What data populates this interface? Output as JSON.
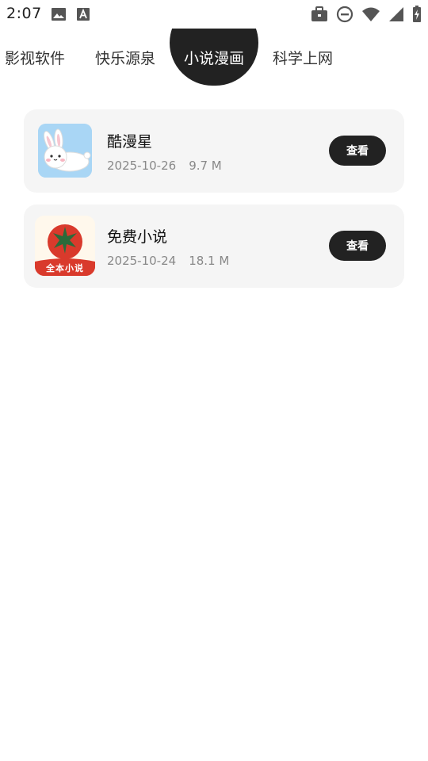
{
  "status_bar": {
    "time": "2:07",
    "left_icons": [
      "image-icon",
      "font-a-icon"
    ],
    "right_icons": [
      "briefcase-icon",
      "do-not-disturb-icon",
      "wifi-icon",
      "signal-icon",
      "battery-charging-icon"
    ]
  },
  "tabs": [
    {
      "label": "影视软件",
      "active": false
    },
    {
      "label": "快乐源泉",
      "active": false
    },
    {
      "label": "小说漫画",
      "active": true
    },
    {
      "label": "科学上网",
      "active": false
    }
  ],
  "apps": [
    {
      "name": "酷漫星",
      "date": "2025-10-26",
      "size": "9.7 M",
      "button": "查看",
      "icon": "bunny-app-icon"
    },
    {
      "name": "免费小说",
      "date": "2025-10-24",
      "size": "18.1 M",
      "button": "查看",
      "icon": "tomato-novel-app-icon",
      "icon_caption": "全本小说"
    }
  ],
  "colors": {
    "active_tab_bg": "#222222",
    "card_bg": "#f5f5f5",
    "button_bg": "#222222",
    "meta_text": "#888888"
  }
}
